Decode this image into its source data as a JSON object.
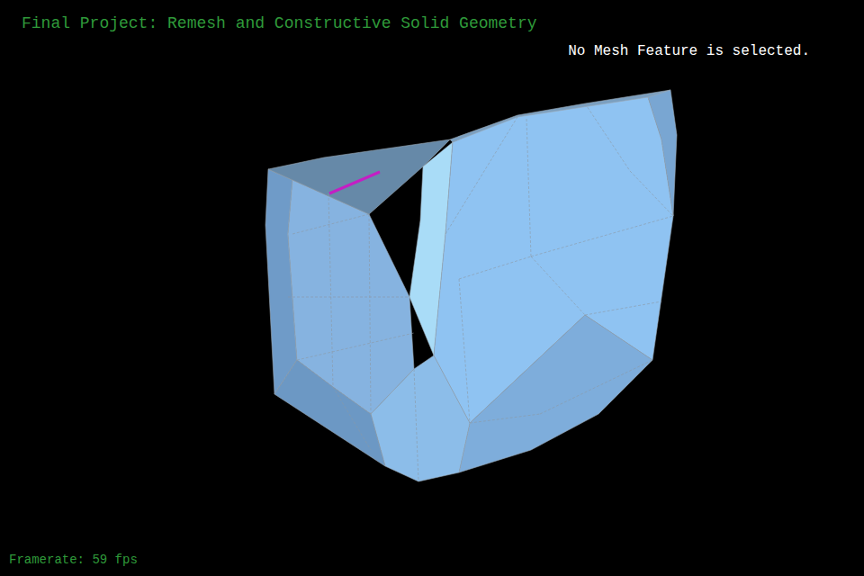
{
  "window": {
    "title": "Final Project: Remesh and Constructive Solid Geometry"
  },
  "status": {
    "text": "No Mesh Feature is selected."
  },
  "footer": {
    "framerate": "Framerate: 59 fps"
  },
  "mesh": {
    "hovered_edge": true
  }
}
